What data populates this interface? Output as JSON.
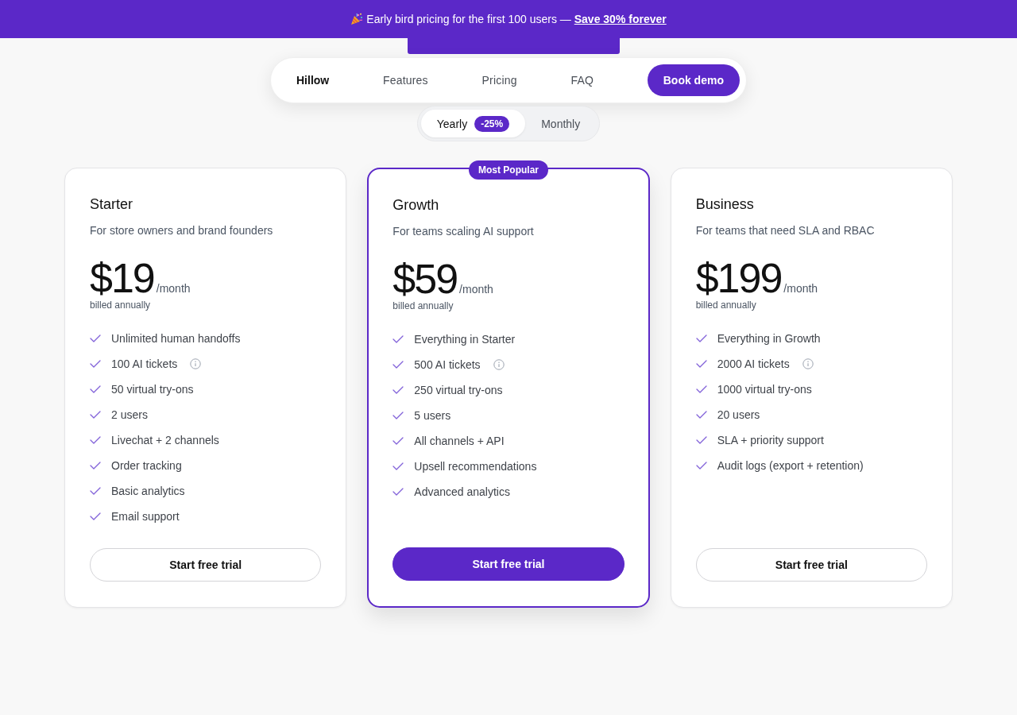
{
  "banner": {
    "text": "Early bird pricing for the first 100 users — ",
    "link": "Save 30% forever"
  },
  "nav": {
    "brand": "Hillow",
    "links": [
      {
        "label": "Features"
      },
      {
        "label": "Pricing"
      },
      {
        "label": "FAQ"
      }
    ],
    "cta": "Book demo"
  },
  "billing_toggle": [
    {
      "label": "Yearly",
      "badge": "-25%",
      "selected": true
    },
    {
      "label": "Monthly",
      "selected": false
    }
  ],
  "plans": [
    {
      "name": "Starter",
      "description": "For store owners and brand founders",
      "price": "$19",
      "period": "/month",
      "billing": "billed annually",
      "featured": false,
      "features": [
        {
          "text": "Unlimited human handoffs",
          "info": false
        },
        {
          "text": "100 AI tickets",
          "info": true
        },
        {
          "text": "50 virtual try-ons",
          "info": false
        },
        {
          "text": "2 users",
          "info": false
        },
        {
          "text": "Livechat + 2 channels",
          "info": false
        },
        {
          "text": "Order tracking",
          "info": false
        },
        {
          "text": "Basic analytics",
          "info": false
        },
        {
          "text": "Email support",
          "info": false
        }
      ],
      "button": "Start free trial"
    },
    {
      "name": "Growth",
      "badge": "Most Popular",
      "description": "For teams scaling AI support",
      "price": "$59",
      "period": "/month",
      "billing": "billed annually",
      "featured": true,
      "features": [
        {
          "text": "Everything in Starter",
          "info": false
        },
        {
          "text": "500 AI tickets",
          "info": true
        },
        {
          "text": "250 virtual try-ons",
          "info": false
        },
        {
          "text": "5 users",
          "info": false
        },
        {
          "text": "All channels + API",
          "info": false
        },
        {
          "text": "Upsell recommendations",
          "info": false
        },
        {
          "text": "Advanced analytics",
          "info": false
        }
      ],
      "button": "Start free trial"
    },
    {
      "name": "Business",
      "description": "For teams that need SLA and RBAC",
      "price": "$199",
      "period": "/month",
      "billing": "billed annually",
      "featured": false,
      "features": [
        {
          "text": "Everything in Growth",
          "info": false
        },
        {
          "text": "2000 AI tickets",
          "info": true
        },
        {
          "text": "1000 virtual try-ons",
          "info": false
        },
        {
          "text": "20 users",
          "info": false
        },
        {
          "text": "SLA + priority support",
          "info": false
        },
        {
          "text": "Audit logs (export + retention)",
          "info": false
        }
      ],
      "button": "Start free trial"
    }
  ]
}
